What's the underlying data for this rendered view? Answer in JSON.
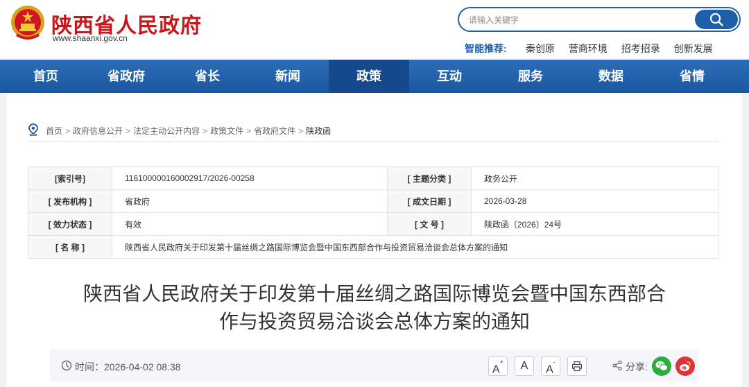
{
  "header": {
    "site_title": "陕西省人民政府",
    "site_url": "www.shaanxi.gov.cn",
    "search_placeholder": "请输入关键字",
    "smart_label": "智能推荐:",
    "smart_links": [
      "秦创原",
      "营商环境",
      "招考招录",
      "创新发展"
    ]
  },
  "nav": {
    "items": [
      "首页",
      "省政府",
      "省长",
      "新闻",
      "政策",
      "互动",
      "服务",
      "数据",
      "省情"
    ],
    "active_index": 4
  },
  "breadcrumb": {
    "items": [
      "首页",
      "政府信息公开",
      "法定主动公开内容",
      "政策文件",
      "省政府文件"
    ],
    "current": "陕政函",
    "separator": ">"
  },
  "meta": {
    "index_no_label": "[索引号]",
    "index_no": "116100000160002917/2026-00258",
    "topic_label": "[ 主题分类 ]",
    "topic": "政务公开",
    "publisher_label": "[ 发布机构 ]",
    "publisher": "省政府",
    "date_label": "[ 成文日期 ]",
    "date": "2026-03-28",
    "status_label": "[ 效力状态 ]",
    "status": "有效",
    "docno_label": "[ 文 号 ]",
    "docno": "陕政函〔2026〕24号",
    "name_label": "[ 名 称 ]",
    "name": "陕西省人民政府关于印发第十届丝绸之路国际博览会暨中国东西部合作与投资贸易洽谈会总体方案的通知"
  },
  "article": {
    "title_line1": "陕西省人民政府关于印发第十届丝绸之路国际博览会暨中国东西部合",
    "title_line2": "作与投资贸易洽谈会总体方案的通知",
    "time": "时间：2026-04-02 08:38",
    "font_larger": "A",
    "font_normal": "A",
    "font_smaller": "A",
    "share_label": "分享:"
  },
  "colors": {
    "brand_blue": "#1f5fa9",
    "brand_red": "#c8161d",
    "wechat_green": "#2aae3c",
    "weibo_red": "#e0343b"
  }
}
